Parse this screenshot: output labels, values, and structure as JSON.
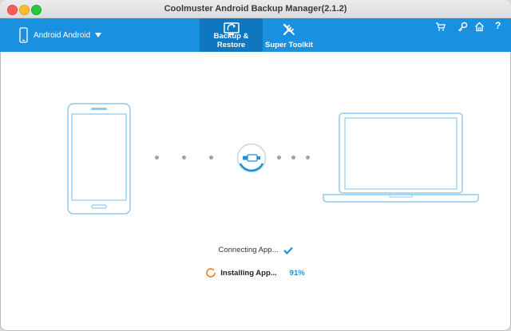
{
  "window": {
    "title": "Coolmuster Android Backup Manager(2.1.2)"
  },
  "toolbar": {
    "device_label": "Android Android",
    "tabs": [
      {
        "label": "Backup & Restore",
        "icon": "backup-restore-icon",
        "active": true
      },
      {
        "label": "Super Toolkit",
        "icon": "tools-icon",
        "active": false
      }
    ],
    "right_icons": [
      "cart-icon",
      "key-icon",
      "home-icon",
      "help-icon"
    ],
    "help_glyph": "?"
  },
  "status": {
    "connecting": {
      "label": "Connecting App...",
      "state": "done"
    },
    "installing": {
      "label": "Installing App...",
      "progress": "91%",
      "state": "in-progress"
    }
  },
  "colors": {
    "accent": "#1a91e0",
    "accent_dark": "#0f76c0",
    "device_outline": "#8fcaf0",
    "spinner": "#f5862a"
  }
}
